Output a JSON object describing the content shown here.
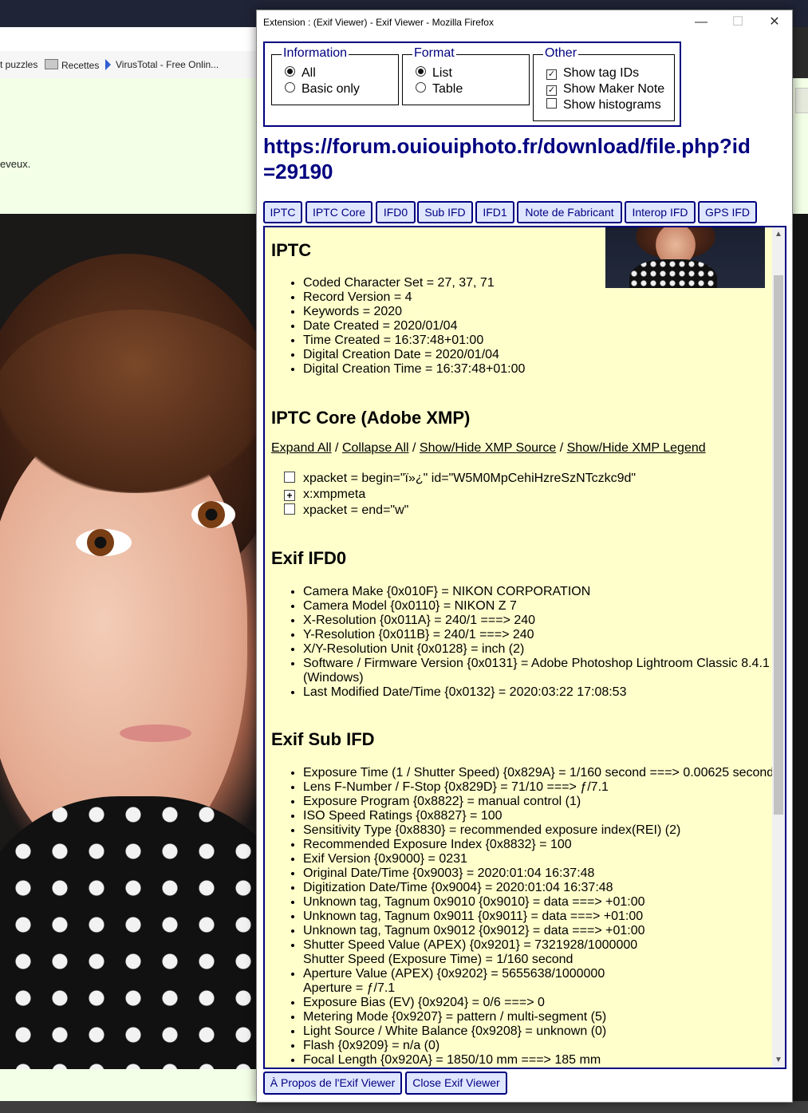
{
  "background": {
    "bookmarks": [
      "t puzzles",
      "Recettes",
      "VirusTotal - Free Onlin..."
    ],
    "page_text": "eveux."
  },
  "window": {
    "title": "Extension : (Exif Viewer) - Exif Viewer - Mozilla Firefox",
    "minimize": "—",
    "maximize": "☐",
    "close": "✕"
  },
  "options": {
    "information": {
      "legend": "Information",
      "items": [
        "All",
        "Basic only"
      ],
      "selected": "All"
    },
    "format": {
      "legend": "Format",
      "items": [
        "List",
        "Table"
      ],
      "selected": "List"
    },
    "other": {
      "legend": "Other",
      "items": [
        {
          "label": "Show tag IDs",
          "checked": true
        },
        {
          "label": "Show Maker Note",
          "checked": true
        },
        {
          "label": "Show histograms",
          "checked": false
        }
      ]
    }
  },
  "url": "https://forum.ouiouiphoto.fr/download/file.php?id=29190",
  "tabs": [
    "IPTC",
    "IPTC Core",
    "IFD0",
    "Sub IFD",
    "IFD1",
    "Note de Fabricant",
    "Interop IFD",
    "GPS IFD"
  ],
  "sections": {
    "iptc": {
      "title": "IPTC",
      "items": [
        "Coded Character Set = 27, 37, 71",
        "Record Version = 4",
        "Keywords = 2020",
        "Date Created = 2020/01/04",
        "Time Created = 16:37:48+01:00",
        "Digital Creation Date = 2020/01/04",
        "Digital Creation Time = 16:37:48+01:00"
      ]
    },
    "iptc_core": {
      "title": "IPTC Core (Adobe XMP)",
      "links": [
        "Expand All",
        "Collapse All",
        "Show/Hide XMP Source",
        "Show/Hide XMP Legend"
      ],
      "separator": " / ",
      "tree": [
        {
          "box": "",
          "text": "xpacket = begin=\"ï»¿\" id=\"W5M0MpCehiHzreSzNTczkc9d\""
        },
        {
          "box": "+",
          "text": "x:xmpmeta"
        },
        {
          "box": "",
          "text": "xpacket = end=\"w\""
        }
      ]
    },
    "ifd0": {
      "title": "Exif IFD0",
      "items": [
        "Camera Make {0x010F} = NIKON CORPORATION",
        "Camera Model {0x0110} = NIKON Z 7",
        "X-Resolution {0x011A} = 240/1 ===> 240",
        "Y-Resolution {0x011B} = 240/1 ===> 240",
        "X/Y-Resolution Unit {0x0128} = inch (2)",
        "Software / Firmware Version {0x0131} = Adobe Photoshop Lightroom Classic 8.4.1",
        "(Windows)",
        "Last Modified Date/Time {0x0132} = 2020:03:22 17:08:53"
      ]
    },
    "subifd": {
      "title": "Exif Sub IFD",
      "items": [
        "Exposure Time (1 / Shutter Speed) {0x829A} = 1/160 second ===> 0.00625 second",
        "Lens F-Number / F-Stop {0x829D} = 71/10 ===> ƒ/7.1",
        "Exposure Program {0x8822} = manual control (1)",
        "ISO Speed Ratings {0x8827} = 100",
        "Sensitivity Type {0x8830} = recommended exposure index(REI) (2)",
        "Recommended Exposure Index {0x8832} = 100",
        "Exif Version {0x9000} = 0231",
        "Original Date/Time {0x9003} = 2020:01:04 16:37:48",
        "Digitization Date/Time {0x9004} = 2020:01:04 16:37:48",
        "Unknown tag, Tagnum 0x9010 {0x9010} = data ===> +01:00",
        "Unknown tag, Tagnum 0x9011 {0x9011} = data ===> +01:00",
        "Unknown tag, Tagnum 0x9012 {0x9012} = data ===> +01:00",
        "Shutter Speed Value (APEX) {0x9201} = 7321928/1000000",
        "Shutter Speed (Exposure Time) = 1/160 second",
        "Aperture Value (APEX) {0x9202} = 5655638/1000000",
        "Aperture = ƒ/7.1",
        "Exposure Bias (EV) {0x9204} = 0/6 ===> 0",
        "Metering Mode {0x9207} = pattern / multi-segment (5)",
        "Light Source / White Balance {0x9208} = unknown (0)",
        "Flash {0x9209} = n/a (0)",
        "Focal Length {0x920A} = 1850/10 mm ===> 185 mm"
      ]
    }
  },
  "footer": {
    "about": "À Propos de l'Exif Viewer",
    "close": "Close Exif Viewer"
  }
}
